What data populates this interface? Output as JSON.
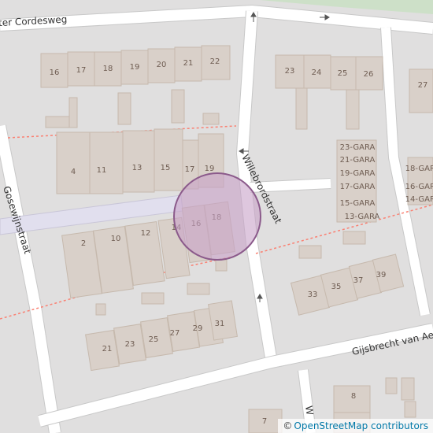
{
  "map": {
    "streets": {
      "top": "Burgemeester Cordesweg",
      "left": "Gosewijnstraat",
      "center": "Willebrordstraat",
      "bottom": "Gijsbrecht van Aemstel",
      "bottom_center": "W"
    },
    "house_numbers": {
      "row_top": [
        "16",
        "17",
        "18",
        "19",
        "20",
        "21",
        "22"
      ],
      "row_top_right": [
        "23",
        "24",
        "25",
        "26",
        "27"
      ],
      "row_mid_upper": [
        "4",
        "11",
        "13",
        "15",
        "17",
        "19"
      ],
      "row_mid_lower": [
        "2",
        "10",
        "12",
        "14",
        "16",
        "18"
      ],
      "garages": [
        "23-GARA",
        "21-GARA",
        "19-GARA",
        "17-GARA",
        "15-GARA",
        "13-GARA"
      ],
      "garages_right": [
        "18-GARA",
        "16-GARA",
        "14-GARA"
      ],
      "row_right_lower": [
        "33",
        "35",
        "37",
        "39"
      ],
      "row_bottom": [
        "21",
        "23",
        "25",
        "27",
        "29",
        "31"
      ],
      "bottom_misc": [
        "8",
        "7"
      ]
    },
    "colors": {
      "background": "#e0dfdf",
      "building": "#d9d0c9",
      "road": "#ffffff",
      "footpath": "#fa8072",
      "marker_fill": "#c8a2c8",
      "marker_stroke": "#8b5a8b",
      "top_green": "#cde0c8"
    },
    "marker": "location-circle"
  },
  "attribution": {
    "symbol": "©",
    "text": "OpenStreetMap contributors"
  }
}
